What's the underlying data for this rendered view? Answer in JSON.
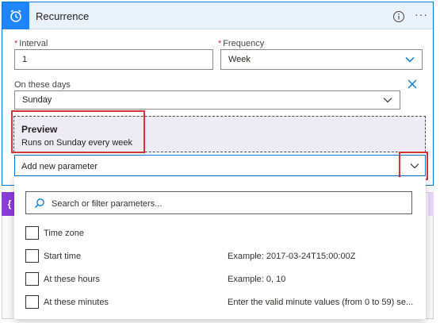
{
  "header": {
    "title": "Recurrence",
    "more_label": "···"
  },
  "interval": {
    "label": "Interval",
    "required_mark": "*",
    "value": "1"
  },
  "frequency": {
    "label": "Frequency",
    "required_mark": "*",
    "value": "Week"
  },
  "on_these_days": {
    "label": "On these days",
    "value": "Sunday"
  },
  "preview": {
    "title": "Preview",
    "description": "Runs on Sunday every week"
  },
  "add_parameter": {
    "label": "Add new parameter"
  },
  "background_card": {
    "icon_text": "{"
  },
  "dropdown": {
    "search_placeholder": "Search or filter parameters...",
    "options": [
      {
        "label": "Time zone",
        "hint": "",
        "checked": false
      },
      {
        "label": "Start time",
        "hint": "Example: 2017-03-24T15:00:00Z",
        "checked": false
      },
      {
        "label": "At these hours",
        "hint": "Example: 0, 10",
        "checked": false
      },
      {
        "label": "At these minutes",
        "hint": "Enter the valid minute values (from 0 to 59) se...",
        "checked": false
      }
    ]
  },
  "colors": {
    "accent": "#0078d4",
    "trigger_tile": "#1f85ff",
    "highlight_red": "#d13438",
    "preview_bg": "#edebf3"
  },
  "icons": {
    "trigger": "alarm-clock-icon",
    "info": "info-icon",
    "chevron": "chevron-down-icon",
    "clear": "close-icon",
    "search": "search-icon"
  }
}
